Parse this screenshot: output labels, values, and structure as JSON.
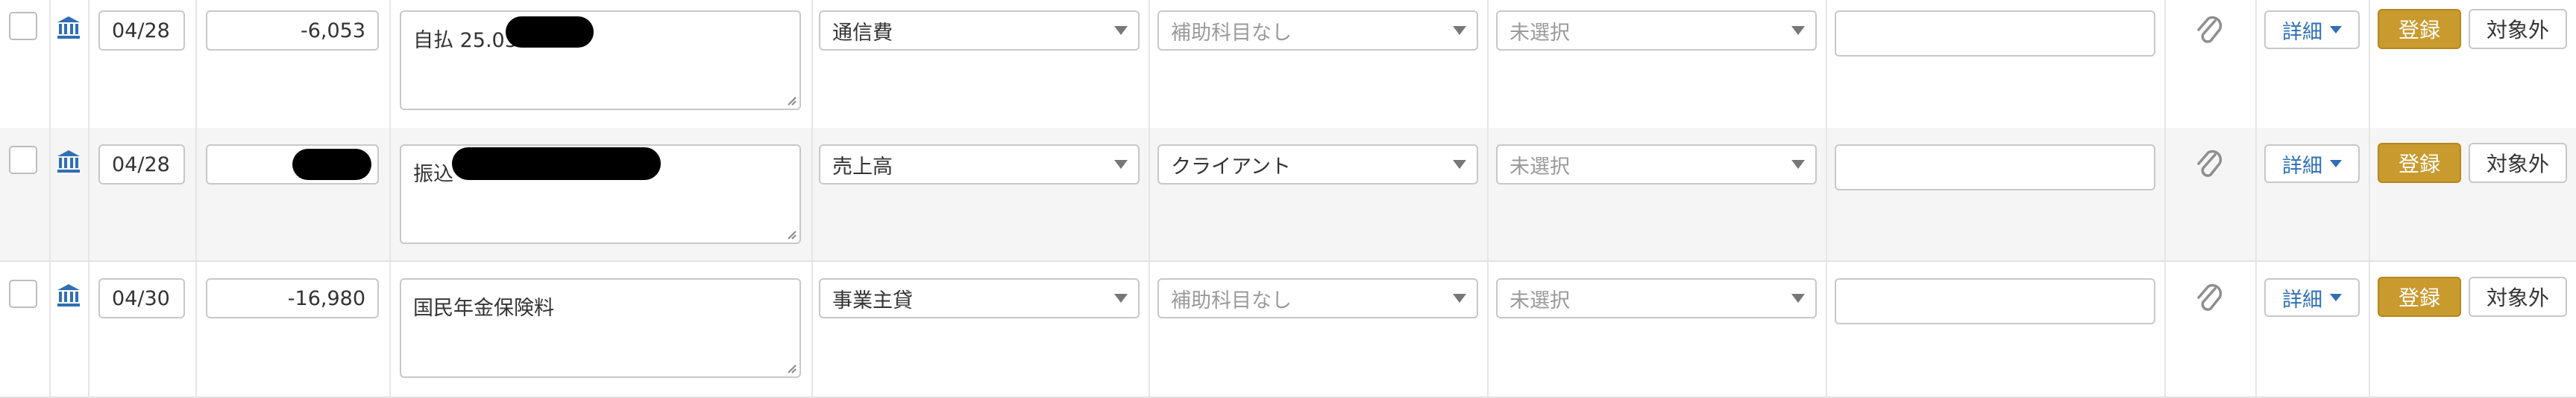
{
  "colors": {
    "register": "#c99a2e",
    "link": "#2f6fb5",
    "alt_row": "#f5f5f5"
  },
  "icons": {
    "bank": "bank-icon",
    "attachment": "paperclip-icon",
    "dropdown": "chevron-down-icon"
  },
  "rows": [
    {
      "date": "04/28",
      "amount": "-6,053",
      "description": "自払 25.03",
      "account": "通信費",
      "sub_account": "補助科目なし",
      "tax": "未選択",
      "memo": "",
      "detail_label": "詳細",
      "register_label": "登録",
      "exclude_label": "対象外"
    },
    {
      "date": "04/28",
      "amount": "",
      "description": "振込",
      "account": "売上高",
      "sub_account": "クライアント",
      "tax": "未選択",
      "memo": "",
      "detail_label": "詳細",
      "register_label": "登録",
      "exclude_label": "対象外"
    },
    {
      "date": "04/30",
      "amount": "-16,980",
      "description": "国民年金保険料",
      "account": "事業主貸",
      "sub_account": "補助科目なし",
      "tax": "未選択",
      "memo": "",
      "detail_label": "詳細",
      "register_label": "登録",
      "exclude_label": "対象外"
    }
  ]
}
